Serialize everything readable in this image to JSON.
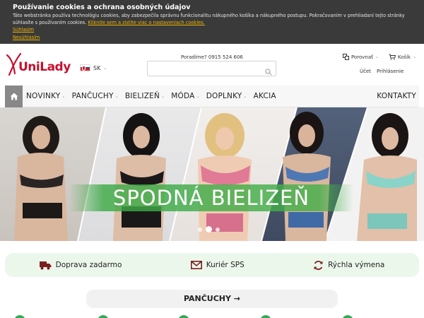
{
  "cookie": {
    "title": "Používanie cookies a ochrana osobných údajov",
    "text": "Táto webstránka používa technológiu cookies, aby zabezpečila správnu funkcionalitu nákupného košíka a nákupného postupu. Pokračovaním v prehliadaní tejto stránky súhlasíte s používaním cookies.",
    "settings_link": "Kliknite sem a zistite viac o nastaveniach cookies.",
    "agree": "Súhlasím",
    "disagree": "Nesúhlasím"
  },
  "header": {
    "logo": "UniLady",
    "lang": "SK",
    "phone": "Poradíme? 0915 524 606",
    "search_placeholder": "",
    "compare": "Porovnať",
    "cart": "Košík",
    "account": "Účet",
    "login": "Prihlásenie"
  },
  "nav": {
    "items": [
      "NOVINKY",
      "PANČUCHY",
      "BIELIZEŇ",
      "MÓDA",
      "DOPLNKY",
      "AKCIA"
    ],
    "contact": "KONTAKTY"
  },
  "hero": {
    "banner": "SPODNÁ BIELIZEŇ",
    "slides": 3,
    "active_slide": 2
  },
  "usp": {
    "items": [
      "Doprava zadarmo",
      "Kuriér SPS",
      "Rýchla výmena"
    ]
  },
  "category_button": "PANČUCHY →",
  "colors": {
    "brand": "#c8102e",
    "usp_bg": "#ecf7ec",
    "banner": "#46af4b",
    "cookie_bg": "#3a3a3a",
    "link": "#f0b400"
  }
}
